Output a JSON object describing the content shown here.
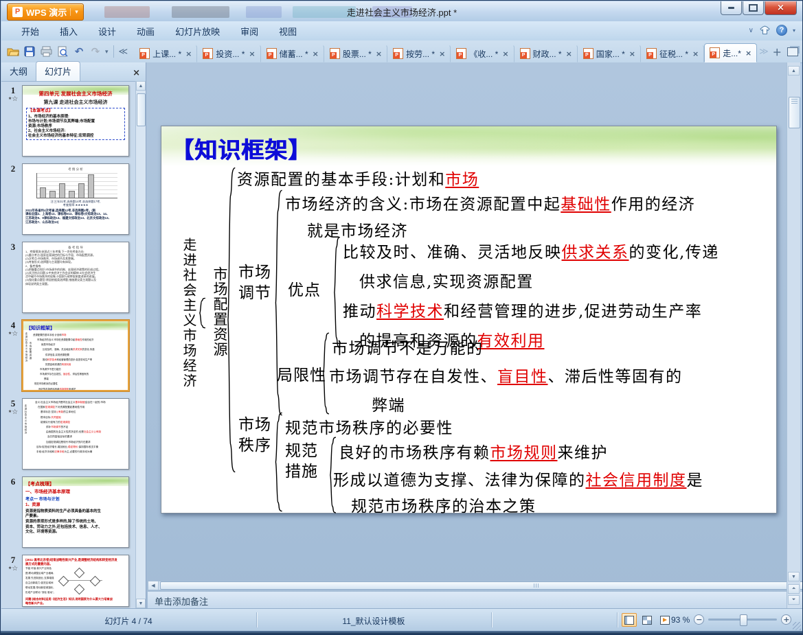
{
  "window": {
    "app_button": "WPS 演示",
    "title": "走进社会主义市场经济.ppt *",
    "menus": [
      "开始",
      "插入",
      "设计",
      "动画",
      "幻灯片放映",
      "审阅",
      "视图"
    ]
  },
  "doc_tabs": {
    "items": [
      {
        "label": "上课... *"
      },
      {
        "label": "投资... *"
      },
      {
        "label": "储蓄... *"
      },
      {
        "label": "股票... *"
      },
      {
        "label": "按劳... *"
      },
      {
        "label": "《收... *"
      },
      {
        "label": "财政... *"
      },
      {
        "label": "国家... *"
      },
      {
        "label": "征税... *"
      },
      {
        "label": "走...*",
        "active": true
      }
    ]
  },
  "sidebar": {
    "outline_tab": "大纲",
    "slides_tab": "幻灯片",
    "close": "×",
    "slides": [
      {
        "n": "1",
        "star": true,
        "band": true,
        "rows": [
          {
            "t": "第四单元 发展社会主义市场经济",
            "c": "#cc0000",
            "s": 7.5,
            "b": true,
            "a": "c",
            "mt": 5
          },
          {
            "t": "第九课  走进社会主义市场经济",
            "c": "#222222",
            "s": 7,
            "b": true,
            "a": "c",
            "mt": 3
          },
          {
            "box": [
              {
                "t": "【本课考点】",
                "c": "#cc0000",
                "s": 6,
                "b": true
              },
              {
                "t": "1、市场经济的基本原理:",
                "c": "#111111",
                "s": 5.5,
                "b": true
              },
              {
                "t": "市场与计划;市场调节及其弊端;市场配置",
                "c": "#111111",
                "s": 5.5,
                "b": true
              },
              {
                "t": "资源;市场秩序",
                "c": "#111111",
                "s": 5.5,
                "b": true
              },
              {
                "t": "2、社会主义市场经济:",
                "c": "#111111",
                "s": 5.5,
                "b": true
              },
              {
                "t": "社会主义市场经济的基本特征;宏观调控",
                "c": "#111111",
                "s": 5.5,
                "b": true
              }
            ]
          }
        ]
      },
      {
        "n": "2",
        "rows": [
          {
            "t": "考 情 分 析",
            "c": "#555555",
            "s": 4.5,
            "a": "c",
            "mt": 3
          },
          {
            "chart": [
              42,
              26,
              58,
              26,
              58,
              95
            ]
          },
          {
            "t": "注:三年31考,选择题14考,非选择题17考,",
            "c": "#223355",
            "s": 4.2,
            "a": "c",
            "mt": 2
          },
          {
            "t": "考查频率:★★★★★",
            "c": "#223355",
            "s": 4.2,
            "a": "c"
          },
          {
            "t": "2011年各省约4次考查,选择题12考,非选择题4考。(新",
            "c": "#112244",
            "s": 4.4,
            "b": true,
            "mt": 2
          },
          {
            "t": "课标全国2、上海卷13、课标卷II13、课标卷I文综政治13、14、",
            "c": "#112244",
            "s": 4.4,
            "b": true
          },
          {
            "t": "江苏政治9、9课标政治13、福建文综政治13、北京文综政治13、",
            "c": "#112244",
            "s": 4.4,
            "b": true
          },
          {
            "t": "江苏政治7、山东政治13)",
            "c": "#112244",
            "s": 4.4,
            "b": true
          }
        ]
      },
      {
        "n": "3",
        "rows": [
          {
            "t": "备 考 指 导",
            "c": "#555555",
            "s": 4.5,
            "a": "c",
            "mt": 3
          },
          {
            "t": "1、考情预测:纵观近三年考情,下一步的考查方向:",
            "c": "#333333",
            "s": 4
          },
          {
            "t": "(1)重点考点:国家宏观调控的目标与手段、市场配置资源。",
            "c": "#333333",
            "s": 4
          },
          {
            "t": "(2)次考点:市场秩序、市场调节及其弊端。",
            "c": "#333333",
            "s": 4
          },
          {
            "t": "(3)考查形式:选择题与主观题均有体现。",
            "c": "#333333",
            "s": 4
          },
          {
            "t": "2、备考指南:",
            "c": "#333333",
            "s": 4
          },
          {
            "t": "(1)把握重点知识:市场调节的机制、宏观经济政策的形成过程。",
            "c": "#333333",
            "s": 4
          },
          {
            "t": "(2)关注热点问题:①中央经济工作会议的精神;②社会经济生",
            "c": "#333333",
            "s": 4
          },
          {
            "t": "活中破坏市场秩序的现象;③国家行政审批制度改革的进展。",
            "c": "#333333",
            "s": 4
          },
          {
            "t": "(3)强化重点题型:原因依据类选择题,措施建议类主观题以及",
            "c": "#333333",
            "s": 4
          },
          {
            "t": "体现说明类主观题。",
            "c": "#333333",
            "s": 4
          }
        ]
      },
      {
        "n": "4",
        "star": true,
        "selected": true,
        "band": true,
        "fw": true,
        "fw_title_color": "#1111cc",
        "fw_indents": [
          10,
          16,
          22,
          24,
          28,
          24,
          28,
          20,
          20,
          26,
          12,
          18,
          16,
          22
        ]
      },
      {
        "n": "5",
        "star": true,
        "vert": "走进社会主义市场经济",
        "rows5": [
          {
            "i": 14,
            "g": [
              "含义:社会主义市场经济是同社会主义",
              "基本制度*",
              "结合在一起的,市场"
            ]
          },
          {
            "i": 18,
            "g": [
              "在国家",
              "宏观调控*",
              "下对资源配置起基础性作用"
            ]
          },
          {
            "i": 22,
            "g": [
              "基本标志:坚持",
              "公有制*",
              "的主体地位"
            ]
          },
          {
            "i": 22,
            "g": [
              "根本目标:",
              "共同富裕*"
            ]
          },
          {
            "i": 22,
            "g": [
              "能够实行强有力的",
              "宏观调控*"
            ]
          },
          {
            "i": 30,
            "g": [
              "弥补",
              "市场调节*",
              "的不足"
            ]
          },
          {
            "i": 30,
            "g": [
              "由我国的社会主义性质决定的,也是",
              "社会主义公有制*"
            ]
          },
          {
            "i": 32,
            "g": [
              "及共同富裕目标的要求"
            ]
          },
          {
            "i": 30,
            "g": [
              "加强宏观调控是现代市场经济的内在要求"
            ]
          },
          {
            "i": 16,
            "g": [
              "目标:促进经济增长,增加就业,",
              "稳定物价*",
              ",保持国际收支平衡"
            ]
          },
          {
            "i": 16,
            "g": [
              "手段:经济手段和",
              "法律手段*",
              "为主,必要的行政手段为辅"
            ]
          }
        ]
      },
      {
        "n": "6",
        "band": true,
        "rows": [
          {
            "t": "【考点梳理】",
            "c": "#cc0000",
            "s": 7,
            "b": true,
            "mt": 4
          },
          {
            "t": "一、市场经济基本原理",
            "c": "#cc0000",
            "s": 6.5,
            "b": true,
            "mt": 3
          },
          {
            "t": "考点一 市场与计划",
            "c": "#0033bb",
            "s": 6,
            "b": true,
            "mt": 3
          },
          {
            "t": "1、资源",
            "c": "#cc0000",
            "s": 6,
            "b": true,
            "mt": 1
          },
          {
            "t": "资源是指物质资料的生产必须具备的基本的生",
            "c": "#111111",
            "s": 5.5,
            "b": true,
            "mt": 1
          },
          {
            "t": "产要素。",
            "c": "#111111",
            "s": 5.5,
            "b": true
          },
          {
            "t": "资源的表现形式是多样的,除了传统的土地、",
            "c": "#111111",
            "s": 5.5,
            "b": true,
            "mt": 1
          },
          {
            "t": "资本、劳动力之外,还包括技术、信息、人才、",
            "c": "#111111",
            "s": 5.5,
            "b": true
          },
          {
            "t": "文化、环境等资源。",
            "c": "#111111",
            "s": 5.5,
            "b": true
          }
        ]
      },
      {
        "n": "7",
        "star": true,
        "clip": 76,
        "rows": [
          {
            "t": "(2011·高考北京卷)培育战略性新兴产业,是调整经济结构和转变经济发",
            "c": "#cc0000",
            "s": 4.4,
            "b": true,
            "mt": 2
          },
          {
            "t": "展方式的重要内容。",
            "c": "#cc0000",
            "s": 4.4,
            "b": true
          },
          {
            "duo": {
              "left": [
                "节能 环保 新兴产业特色",
                "图,联动调整区域产业格局,",
                "发展 先进制造业,支撑增强",
                "自主创新能力,促进区域间",
                "联动发展,带动新型城镇化,",
                "形成产业联动 \"双轮 驱动\"。"
              ]
            }
          },
          {
            "t": "问题:(结合材料)运用《经济生活》知识,说明国家为什么要大力培育战",
            "c": "#cc0000",
            "s": 4.2,
            "b": true,
            "mt": 1
          },
          {
            "t": "略性新兴产业。",
            "c": "#cc0000",
            "s": 4.2,
            "b": true
          }
        ]
      }
    ]
  },
  "slide": {
    "title": "【知识框架】",
    "root": "走进社会主义市场经济",
    "l1": "市场配置资源",
    "labels": {
      "tiaojie": "市场\n调节",
      "youdian": "优点",
      "juxian": "局限性",
      "zhixu": "市场\n秩序",
      "guifan": "规范\n措施"
    },
    "lines": {
      "basic": [
        "资源配置的基本手段:计划和",
        "市场*"
      ],
      "meaning1": [
        "市场经济的含义:市场在资源配置中起",
        "基础性*",
        "作用的经济"
      ],
      "meaning2": [
        "就是市场经济"
      ],
      "adv1a": [
        "比较及时、准确、灵活地反映",
        "供求关系*",
        "的变化,传递"
      ],
      "adv1b": [
        "供求信息,实现资源配置"
      ],
      "adv2a": [
        "推动",
        "科学技术*",
        "和经营管理的进步,促进劳动生产率"
      ],
      "adv2b": [
        "的提高和资源的",
        "有效利用*"
      ],
      "lim1": [
        "市场调节不是万能的"
      ],
      "lim2a": [
        "市场调节存在自发性、",
        "盲目性*",
        "、滞后性等固有的"
      ],
      "lim2b": [
        "弊端"
      ],
      "order1": [
        "规范市场秩序的必要性"
      ],
      "meas1": [
        "良好的市场秩序有赖",
        "市场规则*",
        "来维护"
      ],
      "meas2a": [
        "形成以道德为支撑、法律为保障的",
        "社会信用制度*",
        "是"
      ],
      "meas2b": [
        "规范市场秩序的治本之策"
      ]
    }
  },
  "notes": {
    "placeholder": "单击添加备注"
  },
  "status": {
    "slide_info": "幻灯片 4 / 74",
    "template": "11_默认设计模板",
    "zoom": "93 %"
  },
  "colors": {
    "accent_orange": "#f79617",
    "red_term": "#e00000",
    "title_blue": "#0d0dd8"
  }
}
